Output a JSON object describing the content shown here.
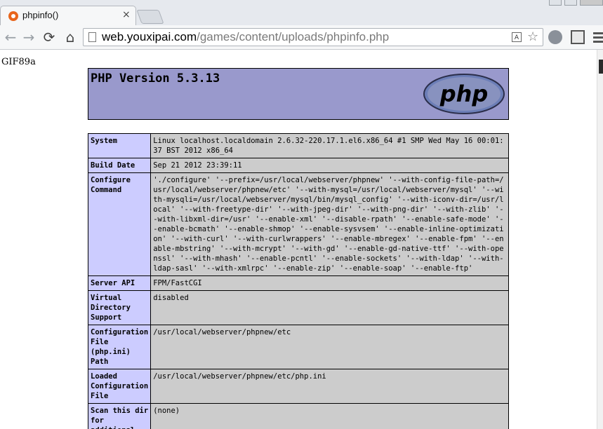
{
  "browser": {
    "tab_title": "phpinfo()",
    "tab_close": "×",
    "url_host": "web.youxipai.com",
    "url_path": "/games/content/uploads/phpinfo.php",
    "back": "←",
    "forward": "→",
    "reload": "⟳",
    "home": "⌂",
    "star": "☆",
    "translate": "A"
  },
  "page": {
    "gif_header": "GIF89a",
    "php_version": "PHP Version 5.3.13",
    "logo_text": "php",
    "rows": [
      {
        "key": "System",
        "value": "Linux localhost.localdomain 2.6.32-220.17.1.el6.x86_64 #1 SMP Wed May 16 00:01:37 BST 2012 x86_64"
      },
      {
        "key": "Build Date",
        "value": "Sep 21 2012 23:39:11"
      },
      {
        "key": "Configure Command",
        "value": "'./configure' '--prefix=/usr/local/webserver/phpnew' '--with-config-file-path=/usr/local/webserver/phpnew/etc' '--with-mysql=/usr/local/webserver/mysql' '--with-mysqli=/usr/local/webserver/mysql/bin/mysql_config' '--with-iconv-dir=/usr/local' '--with-freetype-dir' '--with-jpeg-dir' '--with-png-dir' '--with-zlib' '--with-libxml-dir=/usr' '--enable-xml' '--disable-rpath' '--enable-safe-mode' '--enable-bcmath' '--enable-shmop' '--enable-sysvsem' '--enable-inline-optimization' '--with-curl' '--with-curlwrappers' '--enable-mbregex' '--enable-fpm' '--enable-mbstring' '--with-mcrypt' '--with-gd' '--enable-gd-native-ttf' '--with-openssl' '--with-mhash' '--enable-pcntl' '--enable-sockets' '--with-ldap' '--with-ldap-sasl' '--with-xmlrpc' '--enable-zip' '--enable-soap' '--enable-ftp'"
      },
      {
        "key": "Server API",
        "value": "FPM/FastCGI"
      },
      {
        "key": "Virtual Directory Support",
        "value": "disabled"
      },
      {
        "key": "Configuration File (php.ini) Path",
        "value": "/usr/local/webserver/phpnew/etc"
      },
      {
        "key": "Loaded Configuration File",
        "value": "/usr/local/webserver/phpnew/etc/php.ini"
      },
      {
        "key": "Scan this dir for additional .ini files",
        "value": "(none)"
      }
    ]
  }
}
